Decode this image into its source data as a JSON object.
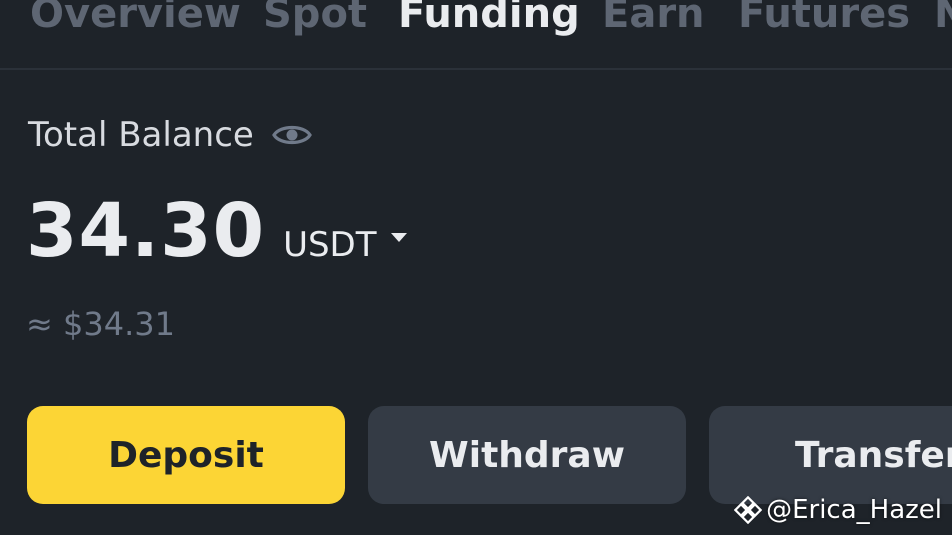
{
  "tabs": [
    {
      "label": "Overview",
      "active": false
    },
    {
      "label": "Spot",
      "active": false
    },
    {
      "label": "Funding",
      "active": true
    },
    {
      "label": "Earn",
      "active": false
    },
    {
      "label": "Futures",
      "active": false
    },
    {
      "label": "N",
      "active": false
    }
  ],
  "balance": {
    "label": "Total Balance",
    "amount": "34.30",
    "currency": "USDT",
    "approx_fiat": "≈ $34.31"
  },
  "actions": {
    "deposit_label": "Deposit",
    "withdraw_label": "Withdraw",
    "transfer_label": "Transfer"
  },
  "watermark": {
    "text": "@Erica_Hazel"
  },
  "colors": {
    "background": "#1e2329",
    "accent": "#fcd535",
    "secondary_button": "#343b45",
    "muted_text": "#707a8a"
  },
  "icons": {
    "visibility": "eye-icon",
    "currency_dropdown": "caret-down-icon",
    "watermark_logo": "binance-logo-icon"
  }
}
